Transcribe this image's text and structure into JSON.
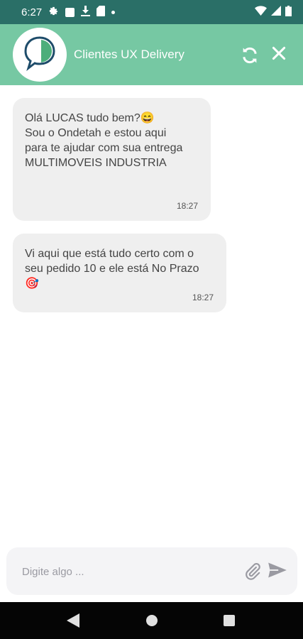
{
  "status_bar": {
    "time": "6:27",
    "icons": [
      "settings-icon",
      "app-icon",
      "download-icon",
      "sd-card-icon",
      "dot-icon",
      "wifi-icon",
      "signal-icon",
      "battery-icon"
    ]
  },
  "header": {
    "title": "Clientes UX Delivery",
    "background": "#76c8a3",
    "icons": [
      "chat-logo-icon",
      "refresh-icon",
      "close-icon"
    ]
  },
  "messages": [
    {
      "text": "Olá LUCAS tudo bem?😄\nSou o Ondetah e estou aqui\npara te ajudar com sua entrega\nMULTIMOVEIS INDUSTRIA",
      "time": "18:27"
    },
    {
      "text": "Vi aqui que está tudo certo com o\nseu pedido 10 e ele está No Prazo\n🎯",
      "time": "18:27"
    }
  ],
  "composer": {
    "placeholder": "Digite algo ...",
    "icons": [
      "attach-icon",
      "send-icon"
    ]
  },
  "nav_bar": {
    "icons": [
      "back-icon",
      "home-icon",
      "recents-icon"
    ]
  },
  "colors": {
    "status_bar": "#2a6f67",
    "header": "#76c8a3",
    "bubble": "#efefef",
    "navbar": "#050505"
  }
}
